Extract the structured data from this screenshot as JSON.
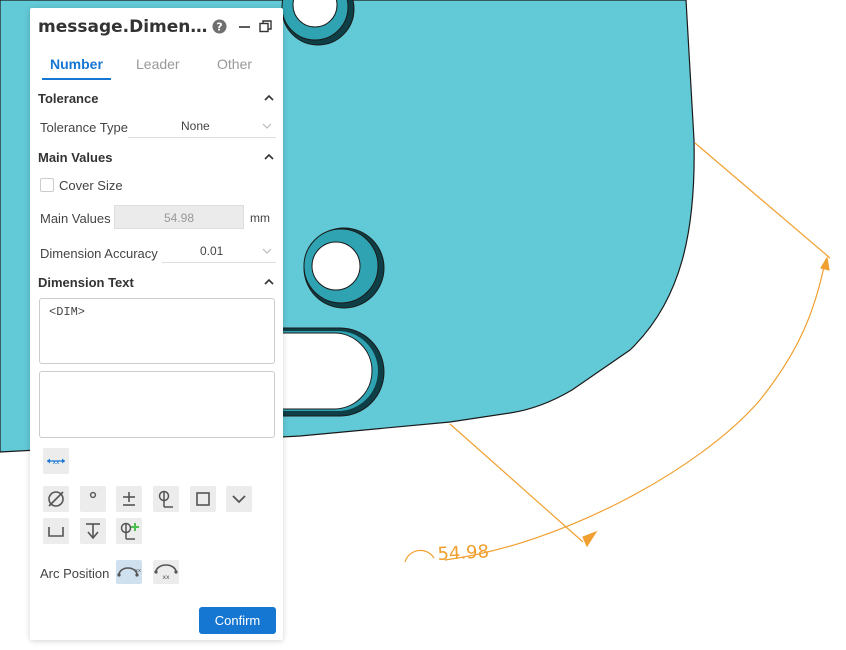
{
  "panel": {
    "title": "message.DimensionStyle",
    "tabs": [
      {
        "label": "Number",
        "active": true
      },
      {
        "label": "Leader",
        "active": false
      },
      {
        "label": "Other",
        "active": false
      }
    ],
    "tolerance": {
      "header": "Tolerance",
      "type_label": "Tolerance Type",
      "type_value": "None"
    },
    "main_values": {
      "header": "Main Values",
      "cover_size_label": "Cover Size",
      "cover_size_checked": false,
      "main_values_label": "Main Values",
      "main_values_value": "54.98",
      "unit": "mm",
      "accuracy_label": "Dimension Accuracy",
      "accuracy_value": "0.01"
    },
    "dimension_text": {
      "header": "Dimension Text",
      "text_value": "<DIM>",
      "secondary_value": ""
    },
    "arc_position_label": "Arc Position",
    "confirm_label": "Confirm"
  },
  "viewport": {
    "dimension_text": "54.98",
    "part_color": "#62c9d6",
    "dimension_color": "#f0a030"
  },
  "colors": {
    "accent": "#1677d2"
  }
}
